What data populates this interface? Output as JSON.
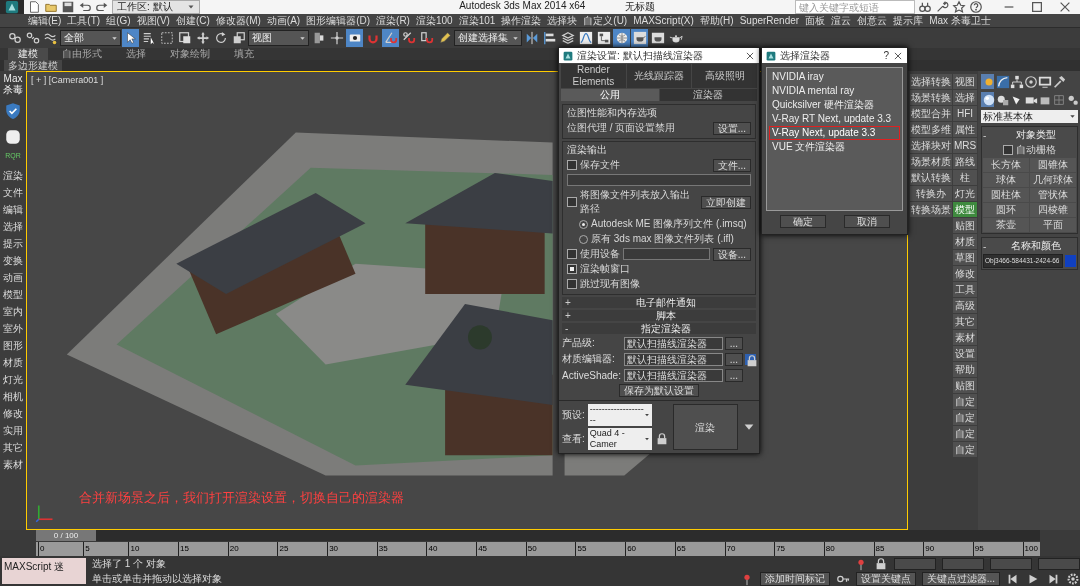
{
  "title_bar": {
    "workspace": "工作区: 默认",
    "title": "Autodesk 3ds Max  2014 x64",
    "document": "无标题",
    "search": {
      "placeholder": "键入关键字或短语"
    }
  },
  "menu": [
    "编辑(E)",
    "工具(T)",
    "组(G)",
    "视图(V)",
    "创建(C)",
    "修改器(M)",
    "动画(A)",
    "图形编辑器(D)",
    "渲染(R)",
    "渲染100",
    "渲染101",
    "操作渲染",
    "选择块",
    "自定义(U)",
    "MAXScript(X)",
    "帮助(H)",
    "SuperRender",
    "面板",
    "渲云",
    "创意云",
    "提示库",
    "Max 杀毒卫士"
  ],
  "toolbar": [
    {
      "kind": "button",
      "active": false
    },
    {
      "kind": "button",
      "active": false
    },
    {
      "kind": "button",
      "active": false
    },
    {
      "kind": "dropdown",
      "value": "全部"
    },
    {
      "kind": "button",
      "active": true
    },
    {
      "kind": "button",
      "active": false
    },
    {
      "kind": "button",
      "active": false
    },
    {
      "kind": "button",
      "active": false
    },
    {
      "kind": "button",
      "active": false
    },
    {
      "kind": "button",
      "active": false
    },
    {
      "kind": "button",
      "active": false
    },
    {
      "kind": "dropdown",
      "value": "视图"
    },
    {
      "kind": "button",
      "active": false
    },
    {
      "kind": "button",
      "active": false
    },
    {
      "kind": "button",
      "active": true
    },
    {
      "kind": "button",
      "active": false
    },
    {
      "kind": "button",
      "active": true
    },
    {
      "kind": "button",
      "active": false
    },
    {
      "kind": "button",
      "active": false
    },
    {
      "kind": "button",
      "active": false
    },
    {
      "kind": "dropdown",
      "value": "创建选择集"
    },
    {
      "kind": "button",
      "active": false
    },
    {
      "kind": "button",
      "active": false
    },
    {
      "kind": "button",
      "active": false
    },
    {
      "kind": "button",
      "active": false
    },
    {
      "kind": "button",
      "active": false
    },
    {
      "kind": "button",
      "active": true
    },
    {
      "kind": "button",
      "active": true
    },
    {
      "kind": "button",
      "active": false
    },
    {
      "kind": "button",
      "active": false
    }
  ],
  "ribbon": {
    "tabs": [
      {
        "label": "建模",
        "selected": true
      },
      {
        "label": "自由形式",
        "selected": false
      },
      {
        "label": "选择",
        "selected": false
      },
      {
        "label": "对象绘制",
        "selected": false
      },
      {
        "label": "填充",
        "selected": false
      }
    ],
    "panel": "多边形建模"
  },
  "left_panel": {
    "header": "Max 杀毒",
    "badge": "RQR",
    "items": [
      "渲染",
      "文件",
      "编辑",
      "选择",
      "提示",
      "变换",
      "动画",
      "模型",
      "室内",
      "室外",
      "图形",
      "材质",
      "灯光",
      "相机",
      "修改",
      "实用",
      "其它",
      "素材"
    ]
  },
  "viewport": {
    "label": "[ + ] [Camera001 ]",
    "annotation": "合并新场景之后，我们打开渲染设置，切换自己的渲染器"
  },
  "render_setup": {
    "title": "渲染设置: 默认扫描线渲染器",
    "tab_rows": [
      [
        {
          "label": "Render Elements",
          "selected": false
        },
        {
          "label": "光线跟踪器",
          "selected": false
        },
        {
          "label": "高级照明",
          "selected": false
        }
      ],
      [
        {
          "label": "公用",
          "selected": true
        },
        {
          "label": "渲染器",
          "selected": false
        }
      ]
    ],
    "bitmap_group": {
      "title": "位图性能和内存选项",
      "text": "位图代理 / 页面设置禁用",
      "button": "设置..."
    },
    "output_group": {
      "title": "渲染输出",
      "rows": [
        {
          "kind": "checkbox",
          "label": "保存文件",
          "checked": false,
          "button": "文件..."
        },
        {
          "kind": "field"
        },
        {
          "kind": "checkbox",
          "label": "将图像文件列表放入输出路径",
          "checked": false,
          "button": "立即创建"
        },
        {
          "kind": "radio",
          "label": "Autodesk ME 图像序列文件 (.imsq)",
          "selected": true
        },
        {
          "kind": "radio",
          "label": "原有 3ds max 图像文件列表 (.ifl)",
          "selected": false
        },
        {
          "kind": "checkbox",
          "label": "使用设备",
          "checked": false,
          "field": true,
          "button": "设备..."
        },
        {
          "kind": "checkbox",
          "label": "渲染帧窗口",
          "checked": true
        },
        {
          "kind": "checkbox",
          "label": "跳过现有图像",
          "checked": false
        }
      ]
    },
    "rollouts": [
      {
        "sign": "+",
        "title": "电子邮件通知"
      },
      {
        "sign": "+",
        "title": "脚本"
      },
      {
        "sign": "-",
        "title": "指定渲染器"
      }
    ],
    "assign": {
      "rows": [
        {
          "label": "产品级:",
          "value": "默认扫描线渲染器",
          "button": "...",
          "locked": false
        },
        {
          "label": "材质编辑器:",
          "value": "默认扫描线渲染器",
          "button": "...",
          "locked": true
        },
        {
          "label": "ActiveShade:",
          "value": "默认扫描线渲染器",
          "button": "...",
          "locked": false
        }
      ],
      "save_button": "保存为默认设置"
    },
    "preset": {
      "label": "预设:",
      "value": "--------------------"
    },
    "view": {
      "label": "查看:",
      "value": "Quad 4 - Camer"
    },
    "render_button": "渲染"
  },
  "choose_renderer": {
    "title": "选择渲染器",
    "help": "?",
    "items": [
      {
        "label": "NVIDIA iray",
        "selected": false
      },
      {
        "label": "NVIDIA mental ray",
        "selected": false
      },
      {
        "label": "Quicksilver 硬件渲染器",
        "selected": false
      },
      {
        "label": "V-Ray RT Next, update 3.3",
        "selected": false
      },
      {
        "label": "V-Ray Next, update 3.3",
        "selected": true
      },
      {
        "label": "VUE 文件渲染器",
        "selected": false
      }
    ],
    "buttons": [
      "确定",
      "取消"
    ]
  },
  "script_buttons": {
    "column_1": [
      "选择转换",
      "场景转换",
      "模型合并",
      "模型多维",
      "选择块对",
      "场景材质",
      "默认转换",
      "转换办",
      "转换场景"
    ],
    "column_2": [
      {
        "label": "视图",
        "selected": false
      },
      {
        "label": "选择",
        "selected": false
      },
      {
        "label": "HFI",
        "selected": false
      },
      {
        "label": "属性",
        "selected": false
      },
      {
        "label": "MRS",
        "selected": false
      },
      {
        "label": "路线",
        "selected": false
      },
      {
        "label": "柱",
        "selected": false
      },
      {
        "label": "灯光",
        "selected": false
      },
      {
        "label": "模型",
        "selected": true
      },
      {
        "label": "贴图",
        "selected": false
      },
      {
        "label": "材质",
        "selected": false
      },
      {
        "label": "草图",
        "selected": false
      },
      {
        "label": "修改",
        "selected": false
      },
      {
        "label": "工具",
        "selected": false
      },
      {
        "label": "高级",
        "selected": false
      },
      {
        "label": "其它",
        "selected": false
      },
      {
        "label": "素材",
        "selected": false
      },
      {
        "label": "设置",
        "selected": false
      },
      {
        "label": "帮助",
        "selected": false
      },
      {
        "label": "贴图",
        "selected": false
      },
      {
        "label": "自定",
        "selected": false
      },
      {
        "label": "自定",
        "selected": false
      },
      {
        "label": "自定",
        "selected": false
      },
      {
        "label": "自定",
        "selected": false
      }
    ]
  },
  "command_panel": {
    "tabs": [
      {
        "selected": true
      },
      {
        "selected": false
      },
      {
        "selected": false
      },
      {
        "selected": false
      },
      {
        "selected": false
      },
      {
        "selected": false
      }
    ],
    "subtabs": [
      {
        "selected": true
      },
      {
        "selected": false
      },
      {
        "selected": false
      },
      {
        "selected": false
      },
      {
        "selected": false
      },
      {
        "selected": false
      },
      {
        "selected": false
      }
    ],
    "dropdown": "标准基本体",
    "object_type": {
      "sign": "-",
      "title": "对象类型",
      "autogrid": {
        "label": "自动栅格",
        "checked": false
      },
      "buttons": [
        "长方体",
        "圆锥体",
        "球体",
        "几何球体",
        "圆柱体",
        "管状体",
        "圆环",
        "四棱锥",
        "茶壶",
        "平面"
      ]
    },
    "name_color": {
      "sign": "-",
      "title": "名称和颜色",
      "name": "Obj3466-584431-2424-66"
    }
  },
  "timeline": {
    "position": "0 / 100",
    "level": 0,
    "ticks": [
      "0",
      "5",
      "10",
      "15",
      "20",
      "25",
      "30",
      "35",
      "40",
      "45",
      "50",
      "55",
      "60",
      "65",
      "70",
      "75",
      "80",
      "85",
      "90",
      "95",
      "100"
    ]
  },
  "status": {
    "listener": "MAXScript 迷",
    "selection": "选择了 1 个 对象",
    "prompt": "单击或单击并拖动以选择对象",
    "add_tag": "添加时间标记",
    "set_key": "设置关键点",
    "key_filter": "关键点过滤器..."
  }
}
